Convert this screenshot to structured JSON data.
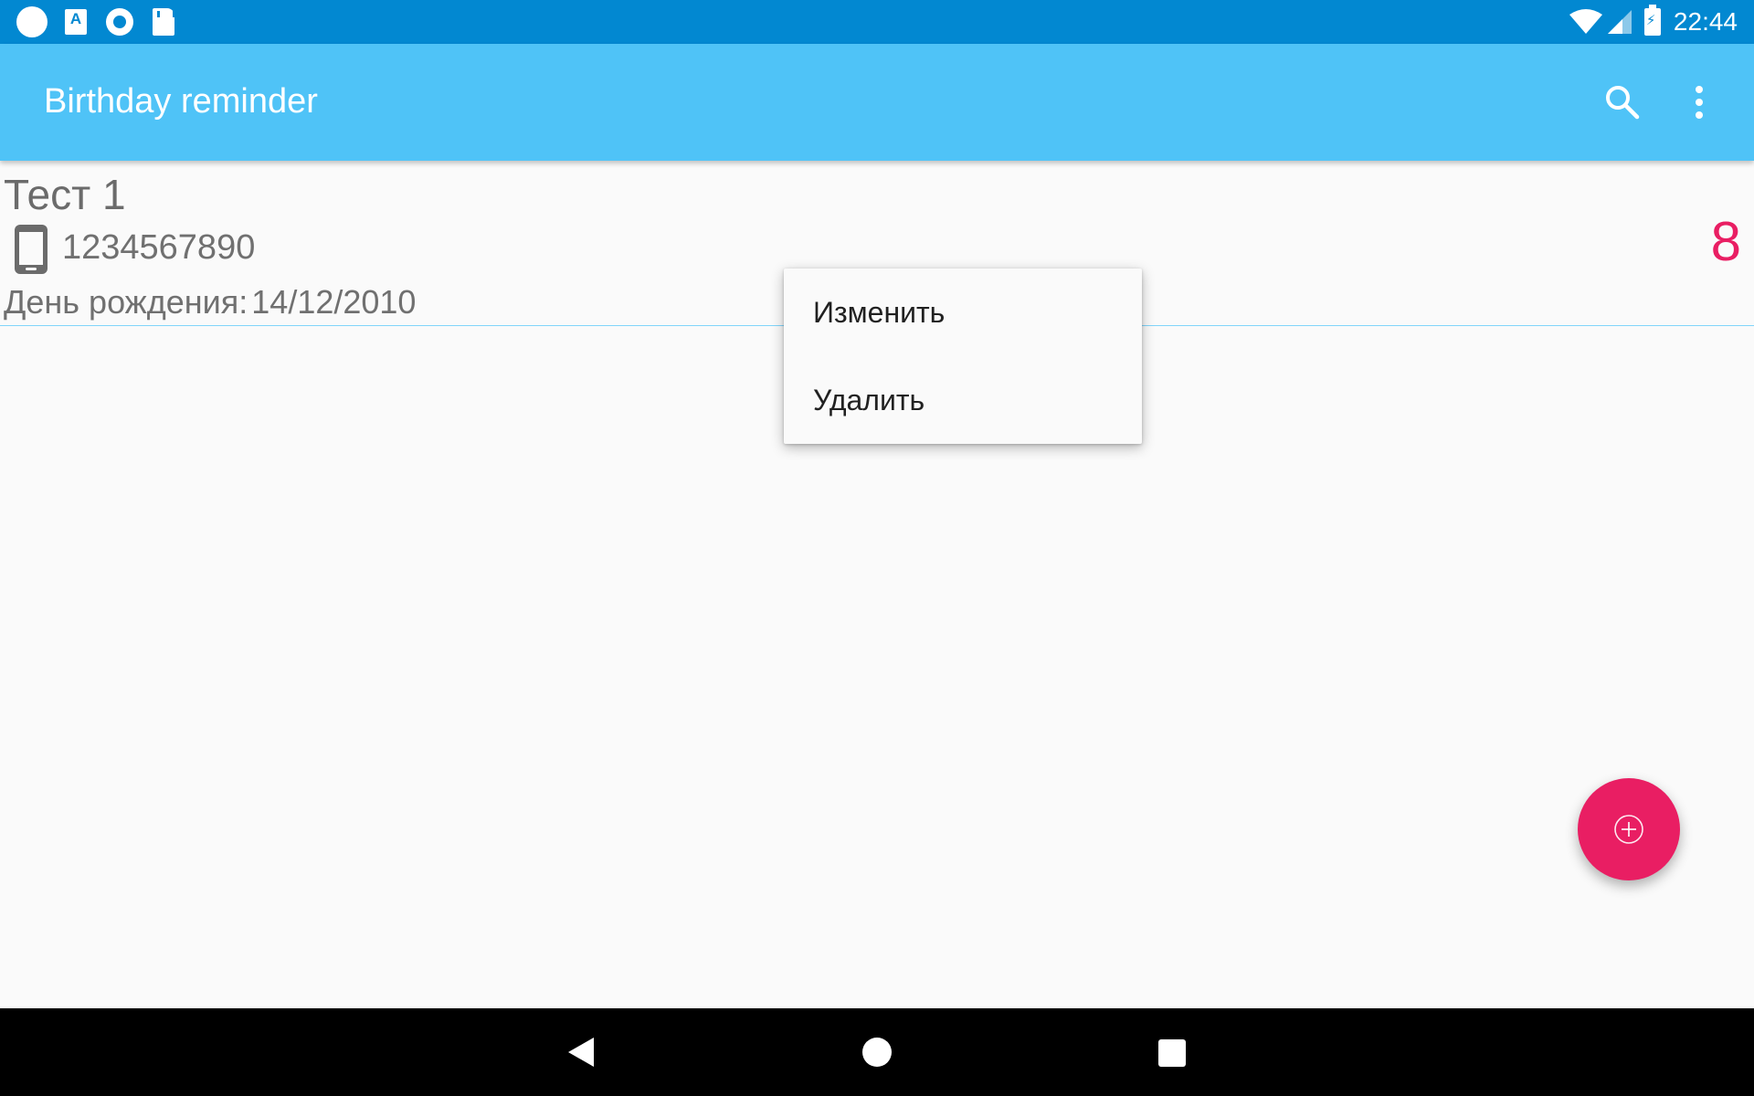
{
  "status_bar": {
    "time": "22:44",
    "left_icons": [
      "notification-dot-icon",
      "font-a-icon",
      "record-icon",
      "sd-card-icon"
    ],
    "right_icons": [
      "wifi-icon",
      "cell-signal-icon",
      "battery-charging-icon"
    ]
  },
  "app_bar": {
    "title": "Birthday reminder",
    "actions": [
      "search-icon",
      "more-vert-icon"
    ],
    "color": "#4fc3f7"
  },
  "contacts": [
    {
      "name": "Тест 1",
      "phone": "1234567890",
      "birthday_label": "День рождения:",
      "birthday": "14/12/2010",
      "days_left": "8"
    }
  ],
  "context_menu": {
    "items": [
      {
        "label": "Изменить"
      },
      {
        "label": "Удалить"
      }
    ]
  },
  "fab": {
    "icon": "add-circle-icon",
    "color": "#e91e63"
  },
  "navigation_bar": {
    "buttons": [
      "back-icon",
      "home-icon",
      "recents-icon"
    ]
  },
  "colors": {
    "status_bar": "#0288d1",
    "accent": "#e91e63",
    "divider": "#81d4fa",
    "background": "#fafafa"
  }
}
